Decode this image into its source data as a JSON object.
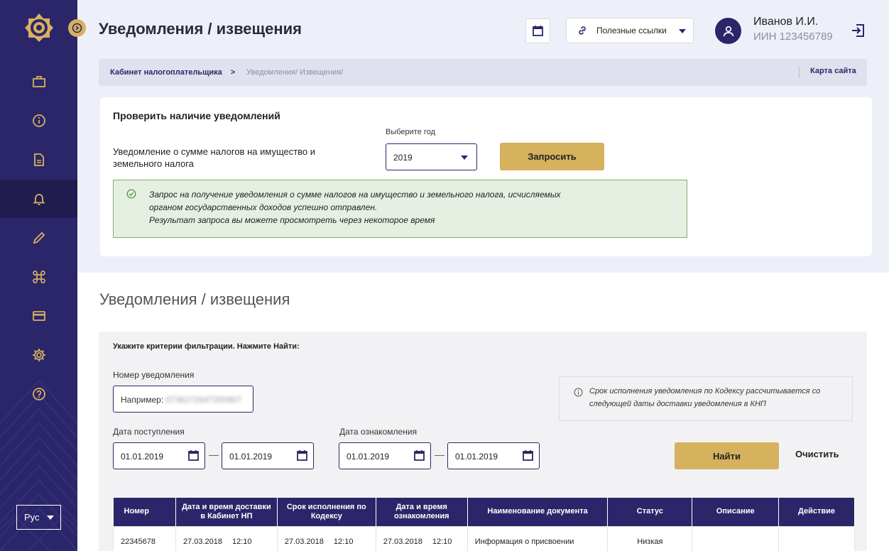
{
  "sidebar": {
    "nav": [
      {
        "name": "briefcase-icon"
      },
      {
        "name": "info-icon"
      },
      {
        "name": "document-icon"
      },
      {
        "name": "bell-icon",
        "active": true
      },
      {
        "name": "pencil-icon"
      },
      {
        "name": "command-icon"
      },
      {
        "name": "card-icon"
      },
      {
        "name": "gear-icon"
      },
      {
        "name": "help-icon"
      }
    ],
    "language": "Рус"
  },
  "header": {
    "title": "Уведомления / извещения",
    "links_label": "Полезные ссылки",
    "user_name": "Иванов И.И.",
    "user_iin": "ИИН 123456789"
  },
  "breadcrumb": {
    "root": "Кабинет налогоплательщика",
    "separator": ">",
    "current": "Уведомления/ Извещения/",
    "sitemap": "Карта сайта"
  },
  "check": {
    "title": "Проверить наличие уведомлений",
    "description": "Уведомление о сумме налогов на имущество и земельного налога",
    "year_label": "Выберите год",
    "year_value": "2019",
    "request_label": "Запросить",
    "success_line1": "Запрос на получение уведомления о сумме налогов на имущество и земельного налога, исчисляемых",
    "success_line2": "органом государственных доходов успешно отправлен.",
    "success_line3": "Результат запроса вы можете просмотреть через некоторое время"
  },
  "list": {
    "title": "Уведомления / извещения",
    "filter_hint": "Укажите  критерии фильтрации. Нажмите Найти:",
    "number_label": "Номер уведомления",
    "number_placeholder_prefix": "Например:",
    "number_placeholder_value": "0736272647200907",
    "info_line1": "Срок исполнения уведомления по Кодексу  рассчитывается со",
    "info_line2": "следующей даты доставки уведомления в КНП",
    "received_label": "Дата поступления",
    "received_from": "01.01.2019",
    "received_to": "01.01.2019",
    "read_label": "Дата ознакомления",
    "read_from": "01.01.2019",
    "read_to": "01.01.2019",
    "find_label": "Найти",
    "clear_label": "Очистить"
  },
  "table": {
    "headers": [
      "Номер",
      "Дата и время доставки в Кабинет НП",
      "Срок исполнения по Кодексу",
      "Дата и время ознакомления",
      "Наименование документа",
      "Статус",
      "Описание",
      "Действие"
    ],
    "rows": [
      {
        "number": "22345678",
        "delivered_date": "27.03.2018",
        "delivered_time": "12:10",
        "due_date": "27.03.2018",
        "due_time": "12:10",
        "read_date": "27.03.2018",
        "read_time": "12:10",
        "doc_name": "Информация о присвоении",
        "status": "Низкая",
        "description": "",
        "action": ""
      }
    ]
  },
  "colors": {
    "primary": "#2b2669",
    "accent": "#d6b15e",
    "success_bg": "#e6f0e2",
    "success_border": "#7fb06f"
  }
}
